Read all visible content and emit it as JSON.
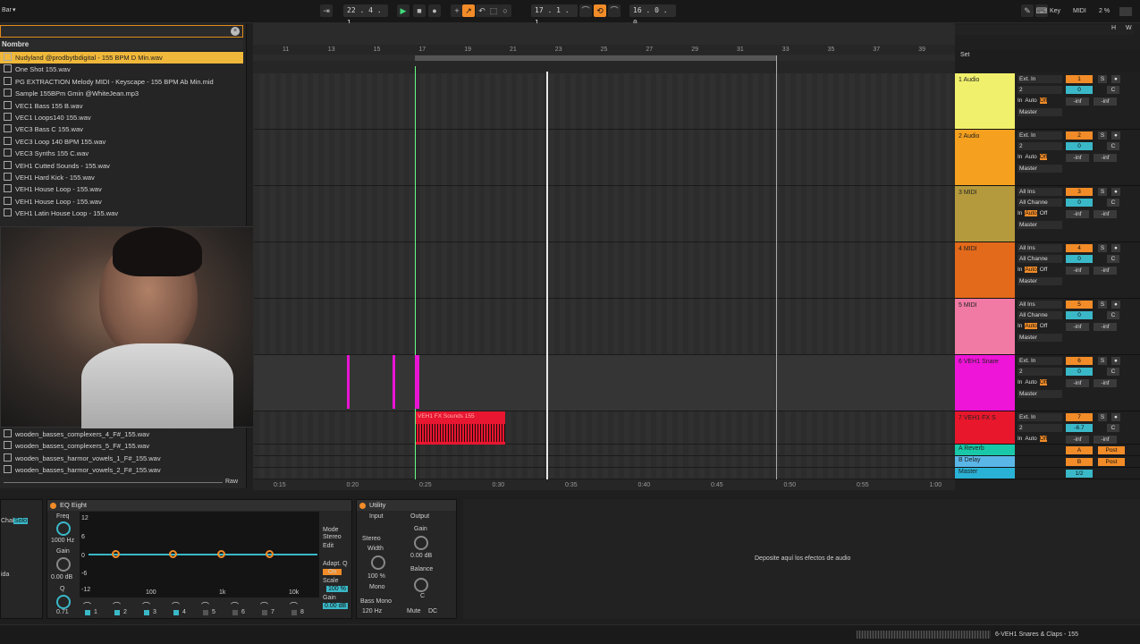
{
  "transport": {
    "left_menu": "Bar",
    "position": "22 . 4 . 1",
    "loop_start": "17 . 1 . 1",
    "loop_length": "16 . 0 . 0",
    "key_label": "Key",
    "midi_label": "MIDI",
    "cpu": "2 %"
  },
  "browser": {
    "column_header": "Nombre",
    "items": [
      "Nudyland @prodbytbdigital - 155 BPM D Min.wav",
      "One Shot 155.wav",
      "PG EXTRACTION Melody MIDI - Keyscape - 155 BPM Ab Min.mid",
      "Sample 155BPm Gmin @WhiteJean.mp3",
      "VEC1 Bass 155 B.wav",
      "VEC1 Loops140 155.wav",
      "VEC3 Bass C 155.wav",
      "VEC3 Loop 140 BPM 155.wav",
      "VEC3 Synths 155 C.wav",
      "VEH1 Cutted Sounds - 155.wav",
      "VEH1 Hard Kick - 155.wav",
      "VEH1 House Loop - 155.wav",
      "VEH1 House Loop - 155.wav",
      "VEH1 Latin House Loop - 155.wav"
    ],
    "bottom_items": [
      "wooden_basses_complexers_4_F#_155.wav",
      "wooden_basses_complexers_5_F#_155.wav",
      "wooden_basses_harmor_vowels_1_F#_155.wav",
      "wooden_basses_harmor_vowels_2_F#_155.wav"
    ],
    "raw_label": "Raw"
  },
  "ruler": {
    "bars": [
      "11",
      "13",
      "15",
      "17",
      "19",
      "21",
      "23",
      "25",
      "27",
      "29",
      "31",
      "33",
      "35",
      "37",
      "39"
    ],
    "times": [
      "0:15",
      "0:20",
      "0:25",
      "0:30",
      "0:35",
      "0:40",
      "0:45",
      "0:50",
      "0:55",
      "1:00"
    ]
  },
  "mixer": {
    "set_label": "Set",
    "tracks": [
      {
        "name": "1 Audio",
        "color": "#f1f06c",
        "input": "Ext. In",
        "ch": "2",
        "num": "1",
        "vol": "0",
        "pan": "C"
      },
      {
        "name": "2 Audio",
        "color": "#f5a01f",
        "input": "Ext. In",
        "ch": "2",
        "num": "2",
        "vol": "0",
        "pan": "C"
      },
      {
        "name": "3 MIDI",
        "color": "#b49a3c",
        "input": "All Ins",
        "ch": "All Channe",
        "num": "3",
        "vol": "0",
        "pan": "C"
      },
      {
        "name": "4 MIDI",
        "color": "#e36a1a",
        "input": "All Ins",
        "ch": "All Channe",
        "num": "4",
        "vol": "0",
        "pan": "C"
      },
      {
        "name": "5 MIDI",
        "color": "#f07aa4",
        "input": "All Ins",
        "ch": "All Channe",
        "num": "5",
        "vol": "0",
        "pan": "C"
      },
      {
        "name": "6 VEH1 Snare",
        "color": "#ee14d8",
        "input": "Ext. In",
        "ch": "2",
        "num": "6",
        "vol": "0",
        "pan": "C"
      },
      {
        "name": "7 VEH1 FX S",
        "color": "#e8172c",
        "input": "Ext. In",
        "ch": "2",
        "num": "7",
        "vol": "-6.7",
        "pan": "C"
      }
    ],
    "returns": [
      {
        "name": "A Reverb",
        "color": "#19c8a8",
        "num": "A",
        "post": "Post"
      },
      {
        "name": "B Delay",
        "color": "#5bb6e8",
        "num": "B",
        "post": "Post"
      },
      {
        "name": "Master",
        "color": "#29b2d6",
        "num": "1/2",
        "post": ""
      }
    ],
    "in_label": "In",
    "auto_label": "Auto",
    "off_label": "Off",
    "master_label": "Master",
    "inf_label": "-inf"
  },
  "clip": {
    "name": "VEH1 FX Sounds 155"
  },
  "devices": {
    "eq_title": "EQ Eight",
    "freq_label": "Freq",
    "freq_val": "1000 Hz",
    "gain_label": "Gain",
    "gain_val": "0.00 dB",
    "q_label": "Q",
    "q_val": "0.71",
    "db_marks": [
      "12",
      "6",
      "0",
      "-6",
      "-12"
    ],
    "freq_marks": [
      "100",
      "1k",
      "10k"
    ],
    "mode_label": "Mode",
    "mode_val": "Stereo",
    "edit_label": "Edit",
    "adapt_label": "Adapt. Q",
    "adapt_val": "On",
    "scale_label": "Scale",
    "scale_val": "100 %",
    "gain2_label": "Gain",
    "gain2_val": "0.00 dB",
    "band_nums": [
      "1",
      "2",
      "3",
      "4",
      "5",
      "6",
      "7",
      "8"
    ],
    "utility_title": "Utility",
    "input_label": "Input",
    "output_label": "Output",
    "stereo_val": "Stereo",
    "width_label": "Width",
    "width_val": "100 %",
    "mono_label": "Mono",
    "bass_mono_label": "Bass Mono",
    "bass_freq": "120 Hz",
    "out_gain_label": "Gain",
    "out_gain_val": "0.00 dB",
    "balance_label": "Balance",
    "balance_val": "C",
    "mute_label": "Mute",
    "dc_label": "DC",
    "left_partial": [
      "Chain",
      "Solo",
      "ida"
    ],
    "drop_hint": "Deposite aquí los efectos de audio"
  },
  "status": {
    "track_name": "6-VEH1 Snares & Claps - 155"
  }
}
